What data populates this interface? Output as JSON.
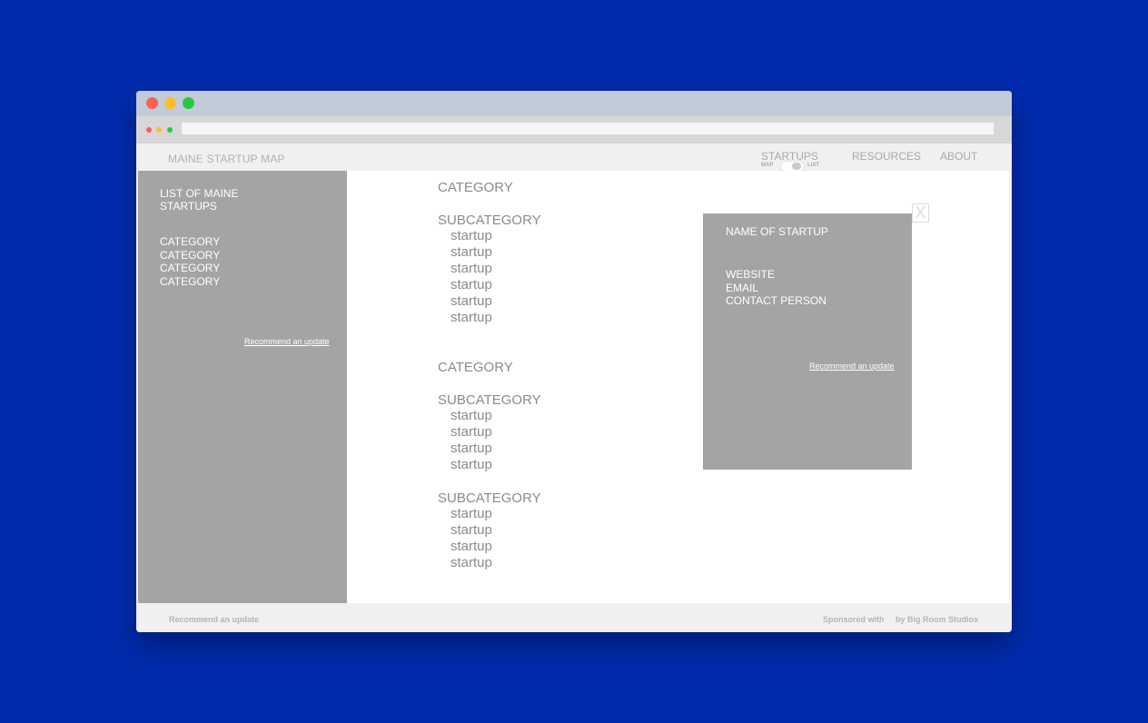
{
  "site": {
    "brand": "MAINE STARTUP MAP",
    "nav": {
      "startups": "STARTUPS",
      "resources": "RESOURCES",
      "about": "ABOUT",
      "toggle_left": "MAP",
      "toggle_right": "LIST"
    }
  },
  "sidebar": {
    "title": "LIST OF MAINE STARTUPS",
    "categories": [
      "CATEGORY",
      "CATEGORY",
      "CATEGORY",
      "CATEGORY"
    ],
    "recommend": "Recommend an update"
  },
  "main": {
    "sections": [
      {
        "category": "CATEGORY",
        "subcategories": [
          {
            "title": "SUBCATEGORY",
            "startups": [
              "startup",
              "startup",
              "startup",
              "startup",
              "startup",
              "startup"
            ]
          }
        ]
      },
      {
        "category": "CATEGORY",
        "subcategories": [
          {
            "title": "SUBCATEGORY",
            "startups": [
              "startup",
              "startup",
              "startup",
              "startup"
            ]
          },
          {
            "title": "SUBCATEGORY",
            "startups": [
              "startup",
              "startup",
              "startup",
              "startup"
            ]
          }
        ]
      }
    ]
  },
  "detail": {
    "name": "NAME OF STARTUP",
    "website": "WEBSITE",
    "email": "EMAIL",
    "contact": "CONTACT PERSON",
    "recommend": "Recommend an update",
    "close": "X"
  },
  "footer": {
    "recommend": "Recommend an update",
    "sponsored": "Sponsored with",
    "studio": "by Big Room Studios"
  },
  "colors": {
    "background": "#002bad",
    "panel_gray": "#a5a4a2",
    "text_gray": "#8b8b8b"
  }
}
